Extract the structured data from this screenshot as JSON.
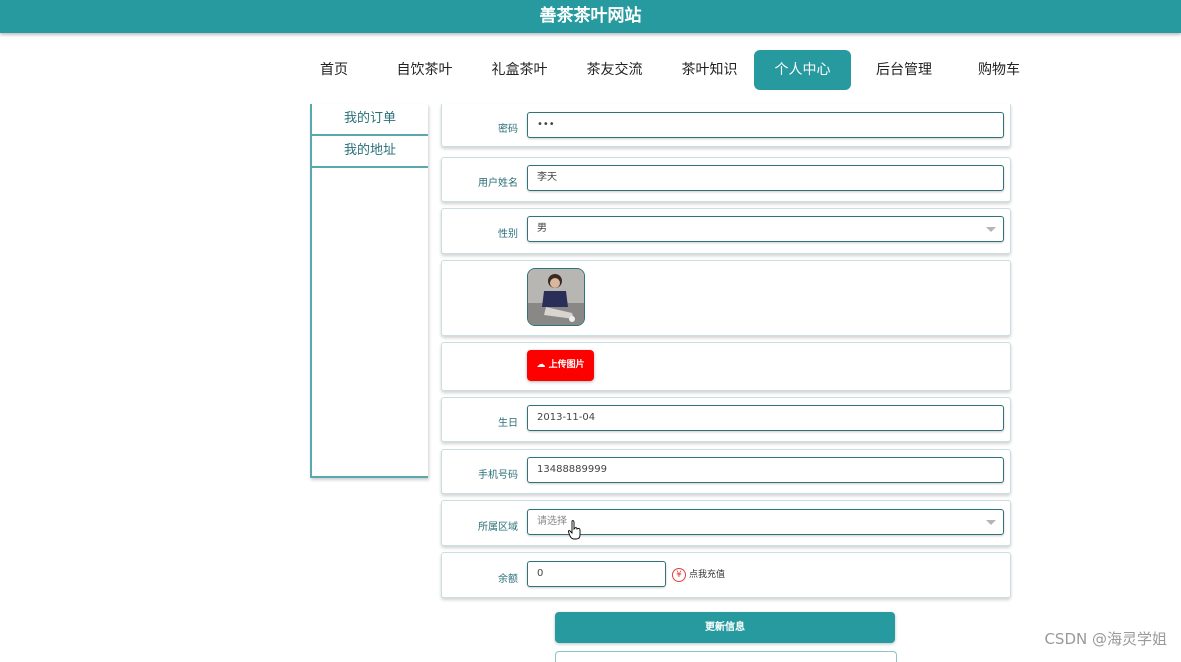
{
  "site": {
    "title": "善茶茶叶网站"
  },
  "nav": {
    "items": [
      "首页",
      "自饮茶叶",
      "礼盒茶叶",
      "茶友交流",
      "茶叶知识",
      "个人中心",
      "后台管理",
      "购物车"
    ],
    "active_index": 5
  },
  "sidebar": {
    "items": [
      "我的订单",
      "我的地址"
    ]
  },
  "form": {
    "password": {
      "label": "密码",
      "value": "•••"
    },
    "username": {
      "label": "用户姓名",
      "value": "李天"
    },
    "gender": {
      "label": "性别",
      "value": "男"
    },
    "upload": {
      "button_label": "上传图片",
      "icon": "cloud-upload-icon"
    },
    "birthday": {
      "label": "生日",
      "value": "2013-11-04"
    },
    "phone": {
      "label": "手机号码",
      "value": "13488889999"
    },
    "region": {
      "label": "所属区域",
      "placeholder": "请选择"
    },
    "balance": {
      "label": "余额",
      "value": "0",
      "recharge_label": "点我充值",
      "recharge_icon": "yen-icon"
    },
    "submit_label": "更新信息"
  },
  "watermark": "CSDN @海灵学姐",
  "colors": {
    "primary": "#269a9e",
    "upload_button": "#ff0000",
    "label_text": "#2a6f78"
  }
}
